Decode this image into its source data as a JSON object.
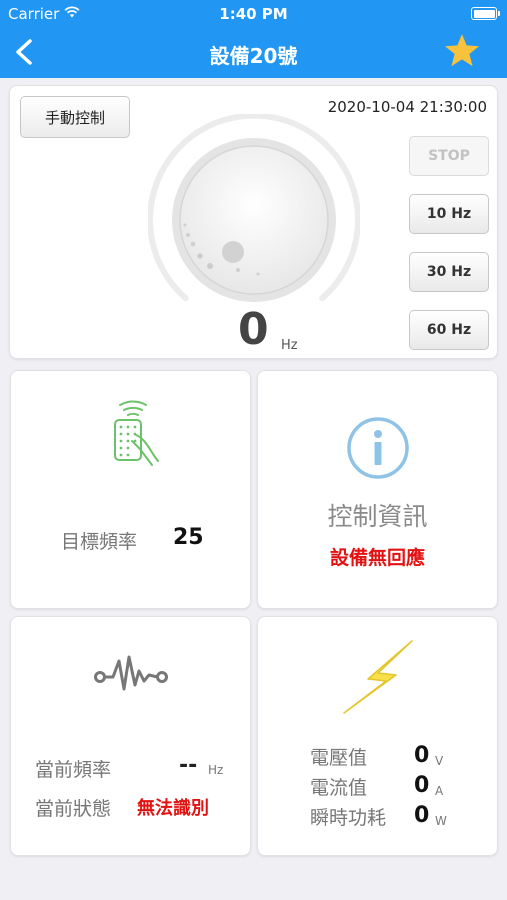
{
  "status_bar": {
    "carrier": "Carrier",
    "time": "1:40 PM"
  },
  "nav": {
    "title": "設備20號",
    "back_icon": "chevron-left-icon",
    "favorite_icon": "star-icon",
    "bar_color": "#2196f3",
    "star_color": "#f9c23c"
  },
  "control": {
    "manual_label": "手動控制",
    "datetime": "2020-10-04 21:30:00",
    "speed_value": "0",
    "speed_unit": "Hz",
    "buttons": [
      {
        "label": "STOP",
        "enabled": false
      },
      {
        "label": "10 Hz",
        "enabled": true
      },
      {
        "label": "30 Hz",
        "enabled": true
      },
      {
        "label": "60 Hz",
        "enabled": true
      }
    ]
  },
  "target": {
    "icon": "remote-control-icon",
    "label": "目標頻率",
    "value": "25"
  },
  "info": {
    "icon": "info-icon",
    "title": "控制資訊",
    "status": "設備無回應",
    "status_color": "#e31212"
  },
  "current": {
    "icon": "pulse-icon",
    "freq_label": "當前頻率",
    "freq_value": "--",
    "freq_unit": "Hz",
    "state_label": "當前狀態",
    "state_value": "無法識別"
  },
  "electric": {
    "icon": "lightning-icon",
    "rows": [
      {
        "label": "電壓值",
        "value": "0",
        "unit": "V"
      },
      {
        "label": "電流值",
        "value": "0",
        "unit": "A"
      },
      {
        "label": "瞬時功耗",
        "value": "0",
        "unit": "W"
      }
    ]
  }
}
